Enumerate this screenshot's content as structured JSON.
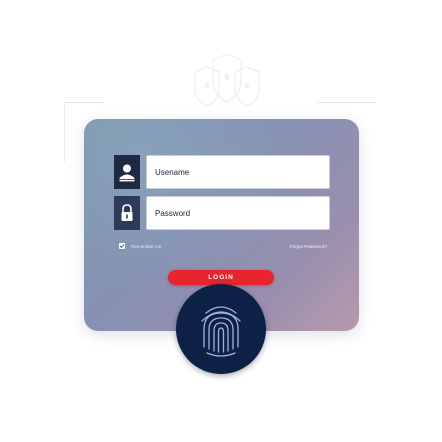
{
  "login_form": {
    "username_placeholder": "Usename",
    "password_placeholder": "Password",
    "remember_label": "Remember me",
    "forgot_label": "Forgot Password?",
    "login_label": "LOGIN"
  },
  "icons": {
    "username": "user-icon",
    "password": "padlock-icon",
    "remember": "checkmark-icon",
    "biometric": "fingerprint-icon",
    "decoration": "shield-icon"
  },
  "colors": {
    "card_gradient_start": "#7c95ad",
    "card_gradient_end": "#b79aab",
    "icon_box": "#1e2a44",
    "login_button": "#e8242d",
    "fingerprint_bg": "#0d2146",
    "fingerprint_lines": "#9fb6d8"
  }
}
